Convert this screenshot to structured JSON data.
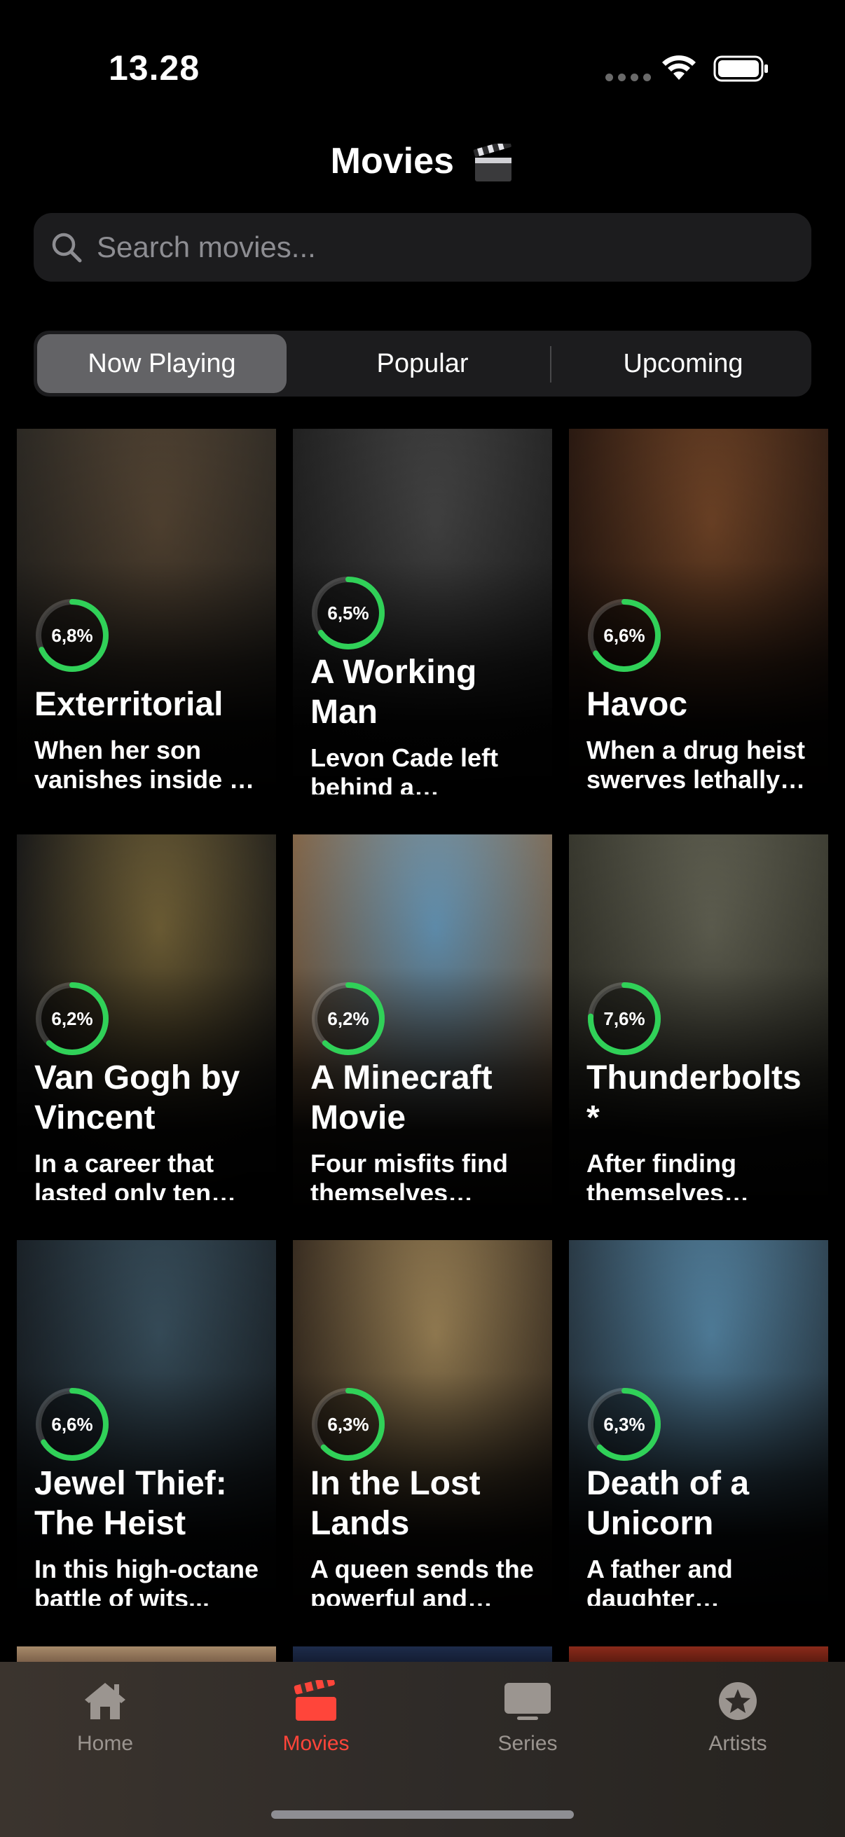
{
  "status_bar": {
    "time": "13.28"
  },
  "header": {
    "title": "Movies",
    "title_icon": "clapper-board-icon"
  },
  "search": {
    "placeholder": "Search movies..."
  },
  "segments": [
    {
      "label": "Now Playing",
      "selected": true
    },
    {
      "label": "Popular",
      "selected": false
    },
    {
      "label": "Upcoming",
      "selected": false
    }
  ],
  "movies": [
    {
      "rating": "6,8%",
      "rating_value": 0.68,
      "title": "Exterritorial",
      "description": "When her son vanishes inside a US military base...",
      "poster_colors": [
        "#5b4a37",
        "#2d2a25"
      ]
    },
    {
      "rating": "6,5%",
      "rating_value": 0.65,
      "title": "A Working Man",
      "description": "Levon Cade left behind a decorated military career...",
      "poster_colors": [
        "#4a4a4a",
        "#222"
      ]
    },
    {
      "rating": "6,6%",
      "rating_value": 0.66,
      "title": "Havoc",
      "description": "When a drug heist swerves lethally out of control...",
      "poster_colors": [
        "#7a4a2a",
        "#2b1a12"
      ]
    },
    {
      "rating": "6,2%",
      "rating_value": 0.62,
      "title": "Van Gogh by Vincent",
      "description": "In a career that lasted only ten years...",
      "poster_colors": [
        "#7c6a3c",
        "#1a1a1a"
      ]
    },
    {
      "rating": "6,2%",
      "rating_value": 0.62,
      "title": "A Minecraft Movie",
      "description": "Four misfits find themselves struggling with ordinary problems...",
      "poster_colors": [
        "#6ea3c7",
        "#8a6a4a"
      ]
    },
    {
      "rating": "7,6%",
      "rating_value": 0.76,
      "title": "Thunderbolts *",
      "description": "After finding themselves ensnared in a death trap...",
      "poster_colors": [
        "#6a6a5a",
        "#3a3a30"
      ]
    },
    {
      "rating": "6,6%",
      "rating_value": 0.66,
      "title": "Jewel Thief: The Heist",
      "description": "In this high-octane battle of wits...",
      "poster_colors": [
        "#3e5766",
        "#1b2228"
      ]
    },
    {
      "rating": "6,3%",
      "rating_value": 0.63,
      "title": "In the Lost Lands",
      "description": "A queen sends the powerful and feared sorceress...",
      "poster_colors": [
        "#a88d5d",
        "#3a2e22"
      ]
    },
    {
      "rating": "6,3%",
      "rating_value": 0.63,
      "title": "Death of a Unicorn",
      "description": "A father and daughter accidentally hit a unicorn...",
      "poster_colors": [
        "#5b8fb0",
        "#2c3c48"
      ]
    }
  ],
  "tabbar": [
    {
      "label": "Home",
      "icon": "house-icon",
      "active": false
    },
    {
      "label": "Movies",
      "icon": "clapper-board-icon",
      "active": true
    },
    {
      "label": "Series",
      "icon": "tv-icon",
      "active": false
    },
    {
      "label": "Artists",
      "icon": "star-circle-icon",
      "active": false
    }
  ],
  "colors": {
    "accent": "#ff453a",
    "rating_ring": "#30d158",
    "tab_inactive": "#9b9590"
  }
}
